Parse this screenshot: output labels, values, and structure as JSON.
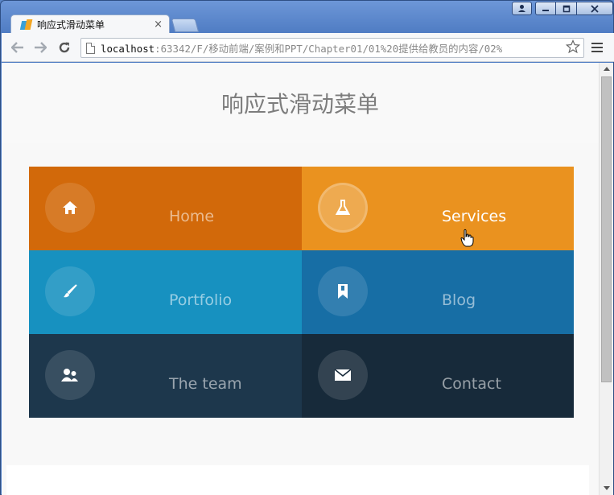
{
  "window": {
    "controls": {
      "user": "user-icon",
      "minimize": "minimize-icon",
      "maximize": "maximize-icon",
      "close": "close-icon"
    }
  },
  "tab": {
    "title": "响应式滑动菜单",
    "close": "×"
  },
  "address_bar": {
    "host": "localhost",
    "path": ":63342/F/移动前端/案例和PPT/Chapter01/01%20提供给教员的内容/02%"
  },
  "page": {
    "title": "响应式滑动菜单",
    "menu": [
      {
        "label": "Home",
        "icon": "home-icon",
        "color": "#d2690a",
        "active": false
      },
      {
        "label": "Services",
        "icon": "flask-icon",
        "color": "#ea921f",
        "active": true
      },
      {
        "label": "Portfolio",
        "icon": "brush-icon",
        "color": "#1791c0",
        "active": false
      },
      {
        "label": "Blog",
        "icon": "bookmark-icon",
        "color": "#176ea5",
        "active": false
      },
      {
        "label": "The team",
        "icon": "team-icon",
        "color": "#1d374c",
        "active": false
      },
      {
        "label": "Contact",
        "icon": "mail-icon",
        "color": "#172a3a",
        "active": false
      }
    ]
  }
}
